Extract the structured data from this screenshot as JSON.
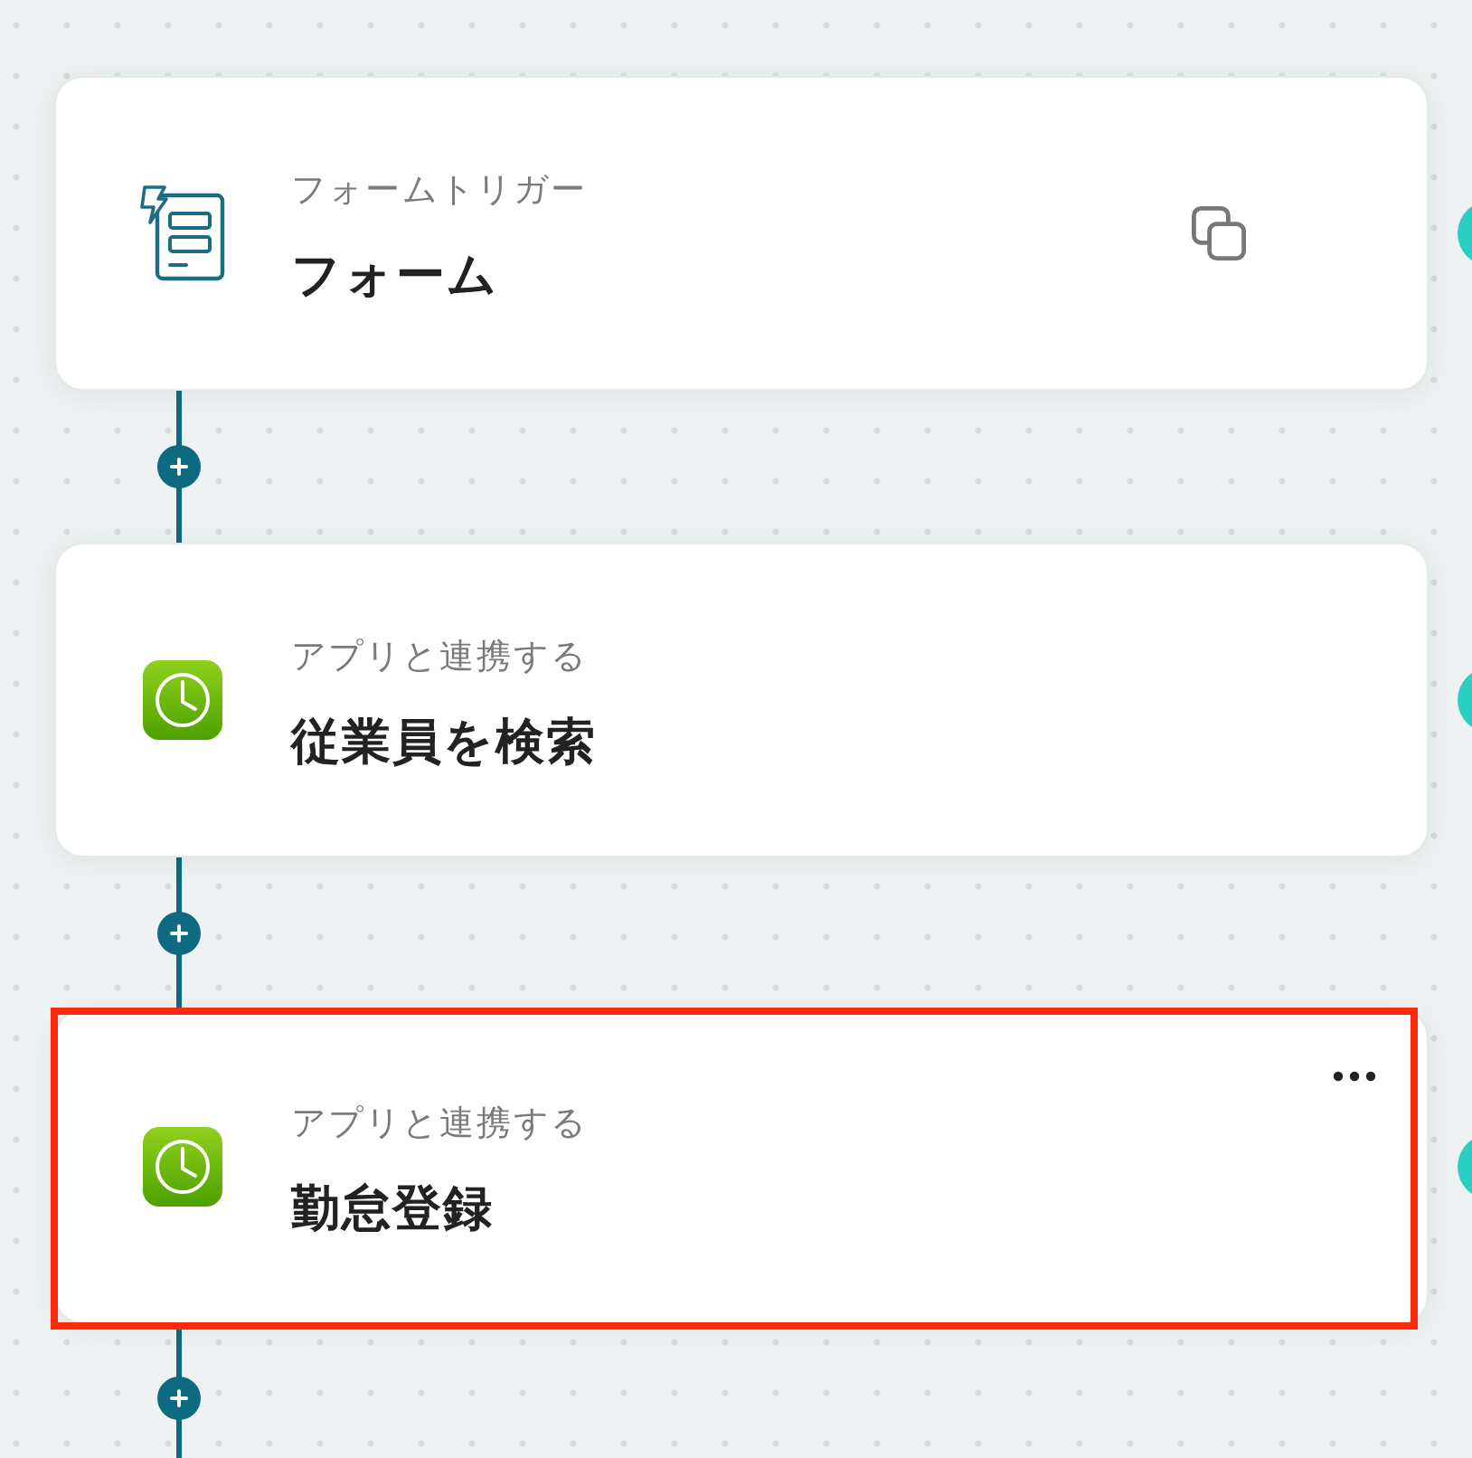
{
  "steps": [
    {
      "kind": "form",
      "label": "フォームトリガー",
      "title": "フォーム",
      "copy_button": true,
      "menu_button": false,
      "highlighted": false
    },
    {
      "kind": "app",
      "label": "アプリと連携する",
      "title": "従業員を検索",
      "copy_button": false,
      "menu_button": false,
      "highlighted": false
    },
    {
      "kind": "app",
      "label": "アプリと連携する",
      "title": "勤怠登録",
      "copy_button": false,
      "menu_button": true,
      "highlighted": true
    }
  ]
}
